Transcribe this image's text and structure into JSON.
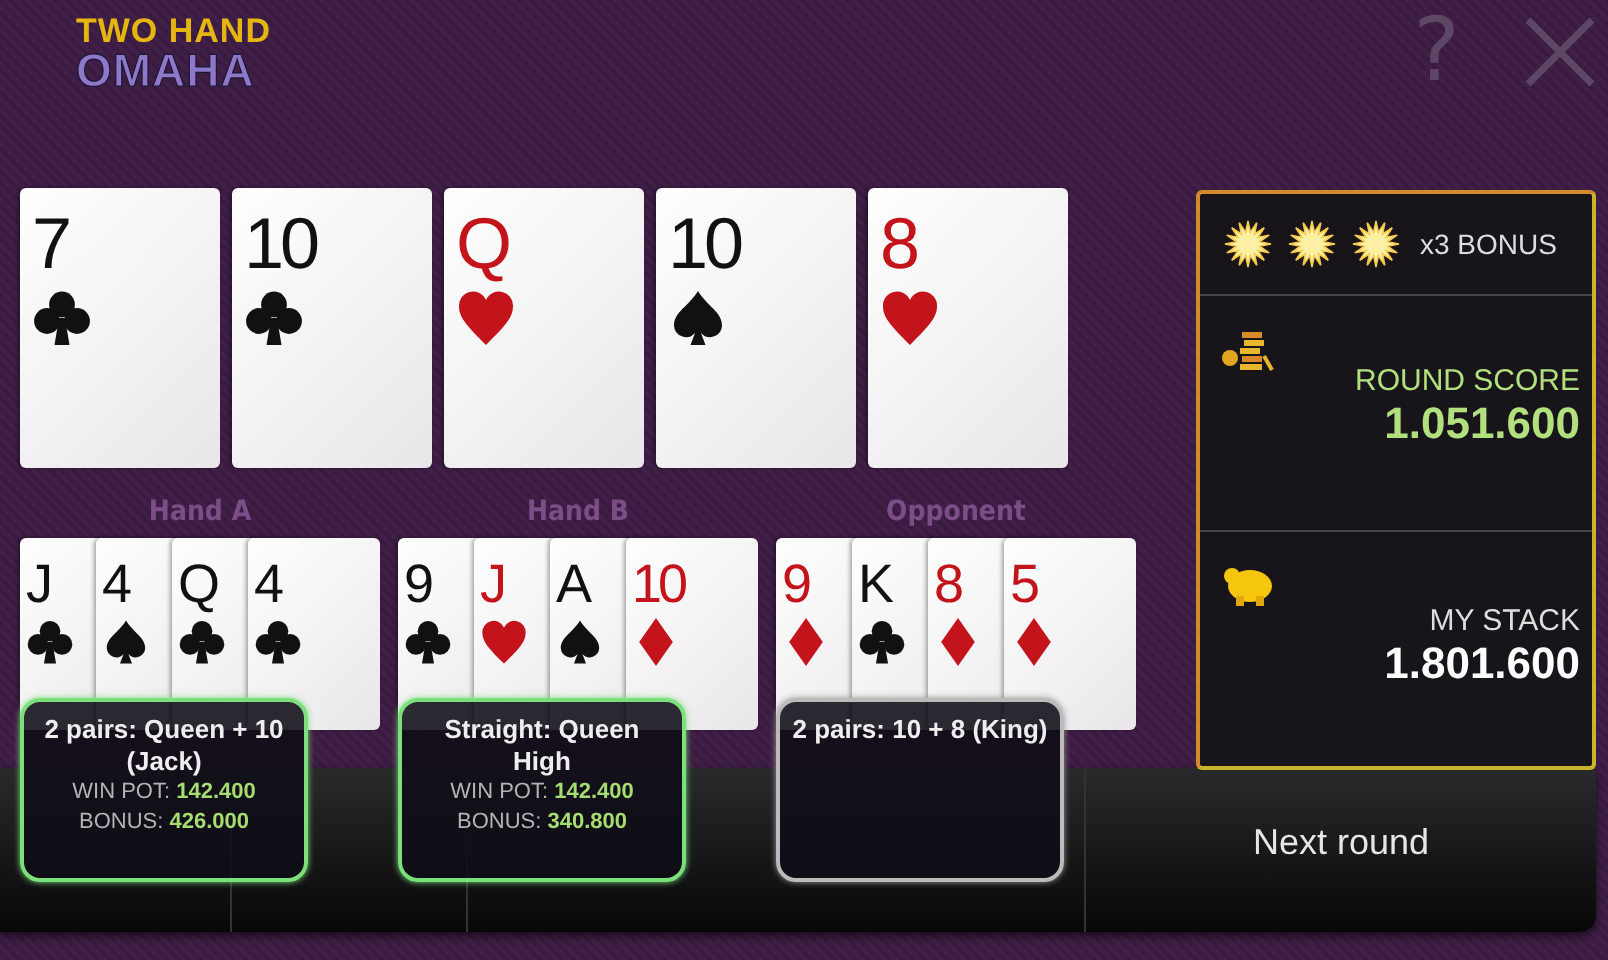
{
  "logo": {
    "line_1": "TWO HAND",
    "line_2": "OMAHA"
  },
  "header": {
    "help": "?"
  },
  "board": [
    {
      "rank": "7",
      "kind": "clubs"
    },
    {
      "rank": "10",
      "kind": "clubs"
    },
    {
      "rank": "Q",
      "kind": "hearts"
    },
    {
      "rank": "10",
      "kind": "spades"
    },
    {
      "rank": "8",
      "kind": "hearts"
    }
  ],
  "hands": [
    {
      "label": "Hand A",
      "cards": [
        {
          "rank": "J",
          "kind": "clubs"
        },
        {
          "rank": "4",
          "kind": "spades"
        },
        {
          "rank": "Q",
          "kind": "clubs"
        },
        {
          "rank": "4",
          "kind": "clubs"
        }
      ],
      "result": {
        "text": "2 pairs: Queen + 10 (Jack)",
        "winner": true,
        "win_pot_label": "WIN POT:",
        "win_pot": "142.400",
        "bonus_label": "BONUS:",
        "bonus": "426.000"
      }
    },
    {
      "label": "Hand B",
      "cards": [
        {
          "rank": "9",
          "kind": "clubs"
        },
        {
          "rank": "J",
          "kind": "hearts"
        },
        {
          "rank": "A",
          "kind": "spades"
        },
        {
          "rank": "10",
          "kind": "diamonds"
        }
      ],
      "result": {
        "text": "Straight: Queen High",
        "winner": true,
        "win_pot_label": "WIN POT:",
        "win_pot": "142.400",
        "bonus_label": "BONUS:",
        "bonus": "340.800"
      }
    },
    {
      "label": "Opponent",
      "cards": [
        {
          "rank": "9",
          "kind": "diamonds"
        },
        {
          "rank": "K",
          "kind": "clubs"
        },
        {
          "rank": "8",
          "kind": "diamonds"
        },
        {
          "rank": "5",
          "kind": "diamonds"
        }
      ],
      "result": {
        "text": "2 pairs: 10 + 8 (King)",
        "winner": false
      }
    }
  ],
  "panel": {
    "bonus": {
      "stars": 3,
      "label": "x3 BONUS"
    },
    "round_score": {
      "label": "ROUND SCORE",
      "value": "1.051.600"
    },
    "my_stack": {
      "label": "MY STACK",
      "value": "1.801.600"
    }
  },
  "next_button": "Next round"
}
